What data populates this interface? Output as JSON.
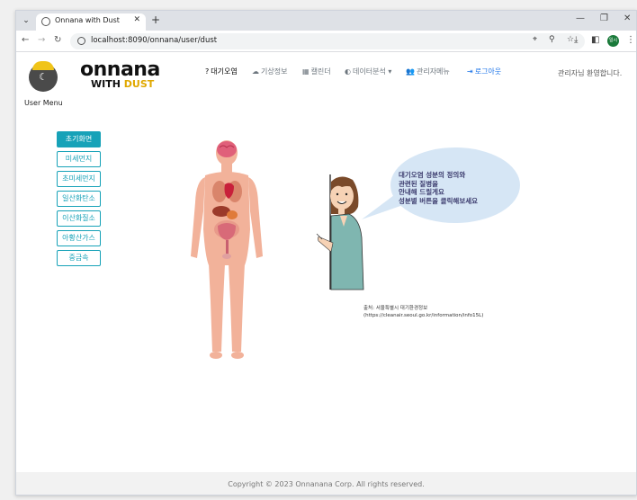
{
  "browser": {
    "tab_title": "Onnana with Dust",
    "url": "localhost:8090/onnana/user/dust",
    "profile_label": "일시"
  },
  "header": {
    "user_menu_label": "User Menu",
    "brand_top": "onnana",
    "brand_bottom_prefix": "WITH ",
    "brand_bottom_highlight": "DUST",
    "nav": [
      {
        "icon": "question-icon",
        "label": "대기오염",
        "color": "#222222"
      },
      {
        "icon": "cloud-sun-icon",
        "label": "기상정보",
        "color": "#6c757d"
      },
      {
        "icon": "calendar-icon",
        "label": "캘린더",
        "color": "#6c757d"
      },
      {
        "icon": "pie-chart-icon",
        "label": "데이터분석",
        "color": "#6c757d",
        "caret": "▾"
      },
      {
        "icon": "users-icon",
        "label": "관리자메뉴",
        "color": "#6c757d"
      },
      {
        "icon": "sign-out-icon",
        "label": "로그아웃",
        "color": "#1a73e8"
      }
    ],
    "welcome": "관리자님 환영합니다."
  },
  "sidebar": {
    "items": [
      {
        "label": "초기화면",
        "active": true
      },
      {
        "label": "미세먼지",
        "active": false
      },
      {
        "label": "초미세먼지",
        "active": false
      },
      {
        "label": "일산화탄소",
        "active": false
      },
      {
        "label": "이산화질소",
        "active": false
      },
      {
        "label": "아황산가스",
        "active": false
      },
      {
        "label": "중금속",
        "active": false
      }
    ]
  },
  "main": {
    "bubble_lines": [
      "대기오염 성분의 정의와",
      "관련된 질병을",
      "안내해 드릴게요",
      "성분별 버튼을 클릭해보세요"
    ],
    "source_lines": [
      "출처: 서울특별시 대기환경정보",
      "(https://cleanair.seoul.go.kr/information/info15L)"
    ]
  },
  "footer": {
    "text": "Copyright © 2023 Onnanana Corp. All rights reserved."
  },
  "colors": {
    "accent": "#17a2b8",
    "brand_yellow": "#e0a800",
    "bubble": "#d6e6f5",
    "skin": "#f2b29a"
  }
}
